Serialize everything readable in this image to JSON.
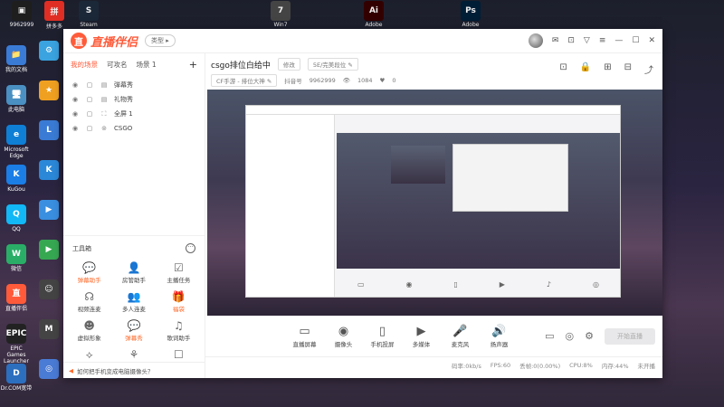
{
  "desktop": {
    "top_apps": [
      {
        "label": "9962999",
        "sub": "",
        "color": "#1e1e1e",
        "glyph": "▣"
      },
      {
        "label": "拼多多",
        "sub": "",
        "color": "#e02e24",
        "glyph": "拼"
      },
      {
        "label": "Steam",
        "sub": "",
        "color": "#1b2838",
        "glyph": "S"
      },
      {
        "label": "Win7",
        "sub": "",
        "color": "#444",
        "glyph": "7"
      },
      {
        "label": "Adobe",
        "sub": "",
        "color": "#330000",
        "glyph": "Ai"
      },
      {
        "label": "Adobe",
        "sub": "",
        "color": "#001e36",
        "glyph": "Ps"
      }
    ],
    "icons": [
      {
        "label": "我的文档",
        "color": "#3a7bd5",
        "glyph": "📁"
      },
      {
        "label": "此电脑",
        "color": "#4a90c2",
        "glyph": "🖥"
      },
      {
        "label": "Microsoft Edge",
        "color": "#0f7fd6",
        "glyph": "e"
      },
      {
        "label": "KuGou",
        "color": "#1a7ee6",
        "glyph": "K"
      },
      {
        "label": "QQ",
        "color": "#12b7f5",
        "glyph": "Q"
      },
      {
        "label": "微信",
        "color": "#2aae67",
        "glyph": "W"
      },
      {
        "label": "直播伴侣",
        "color": "#ff5b3a",
        "glyph": "直"
      },
      {
        "label": "EPIC Games Launcher",
        "color": "#222",
        "glyph": "EPIC"
      },
      {
        "label": "Dr.COM宽带",
        "color": "#2c6fbf",
        "glyph": "D"
      }
    ],
    "icons_col2": [
      {
        "label": "",
        "color": "#3aa3e0",
        "glyph": "⚙"
      },
      {
        "label": "",
        "color": "#f0a020",
        "glyph": "★"
      },
      {
        "label": "",
        "color": "#3a7bd5",
        "glyph": "L"
      },
      {
        "label": "",
        "color": "#2b88d8",
        "glyph": "K"
      },
      {
        "label": "",
        "color": "#3a8fe0",
        "glyph": "▶"
      },
      {
        "label": "",
        "color": "#36a852",
        "glyph": "▶"
      },
      {
        "label": "",
        "color": "#444",
        "glyph": "☺"
      },
      {
        "label": "",
        "color": "#444",
        "glyph": "M"
      },
      {
        "label": "",
        "color": "#4a7bd5",
        "glyph": "◎"
      }
    ]
  },
  "app": {
    "logo_mark": "直",
    "logo_text": "直播伴侣",
    "type_label": "类型",
    "type_arrow": "▸",
    "title_icons": [
      "✉",
      "⊡",
      "▽",
      "≡",
      "—",
      "☐",
      "✕"
    ],
    "scene_tabs": {
      "active": "我的场景",
      "tab2": "可攻名",
      "tab3": "场景 1",
      "plus": "+"
    },
    "sources": [
      {
        "name": "弹幕秀",
        "icon": "▤"
      },
      {
        "name": "礼物秀",
        "icon": "▤"
      },
      {
        "name": "全屏 1",
        "icon": "⛶"
      },
      {
        "name": "CSGO",
        "icon": "⊚"
      }
    ],
    "toolbox": {
      "title": "工具箱",
      "more": "···",
      "tools": [
        {
          "label": "弹幕助手",
          "icon": "💬",
          "accent": true
        },
        {
          "label": "房管助手",
          "icon": "👤",
          "accent": false
        },
        {
          "label": "主播任务",
          "icon": "☑",
          "accent": false
        },
        {
          "label": "视频连麦",
          "icon": "☊",
          "accent": false
        },
        {
          "label": "多人连麦",
          "icon": "👥",
          "accent": false
        },
        {
          "label": "福袋",
          "icon": "🎁",
          "accent": true
        },
        {
          "label": "虚拟形象",
          "icon": "☻",
          "accent": false
        },
        {
          "label": "弹幕秀",
          "icon": "💬",
          "accent": true
        },
        {
          "label": "歌词助手",
          "icon": "♫",
          "accent": false
        },
        {
          "label": "",
          "icon": "⟡",
          "accent": false
        },
        {
          "label": "",
          "icon": "⚘",
          "accent": false
        },
        {
          "label": "",
          "icon": "☐",
          "accent": false
        }
      ]
    },
    "footer_tip": "如何把手机变成电脑摄像头？",
    "footer_icon": "◀",
    "stream": {
      "title": "csgo排位白给中",
      "modify": "修改",
      "category_chip": "5E/完美段位",
      "category": "CF手游 - 排位大神",
      "room_label": "抖音号",
      "room_id": "9962999",
      "viewers": "1084",
      "likes": "0"
    },
    "info_icons": [
      "⊡",
      "🔒",
      "⊞",
      "⊟",
      "⤴"
    ],
    "controls": [
      {
        "label": "直播屏幕",
        "icon": "▭"
      },
      {
        "label": "摄像头",
        "icon": "◉"
      },
      {
        "label": "手机投屏",
        "icon": "▯"
      },
      {
        "label": "多媒体",
        "icon": "▶"
      },
      {
        "label": "麦克风",
        "icon": "🎤"
      },
      {
        "label": "扬声器",
        "icon": "🔊"
      }
    ],
    "ctrl_right_icons": [
      "▭",
      "◎",
      "⚙"
    ],
    "live_button": "开始直播",
    "status": {
      "bitrate": "码率:0kb/s",
      "fps": "FPS:60",
      "drop": "丢帧:0(0.00%)",
      "cpu": "CPU:8%",
      "memory": "内存:44%",
      "state": "未开播"
    }
  }
}
